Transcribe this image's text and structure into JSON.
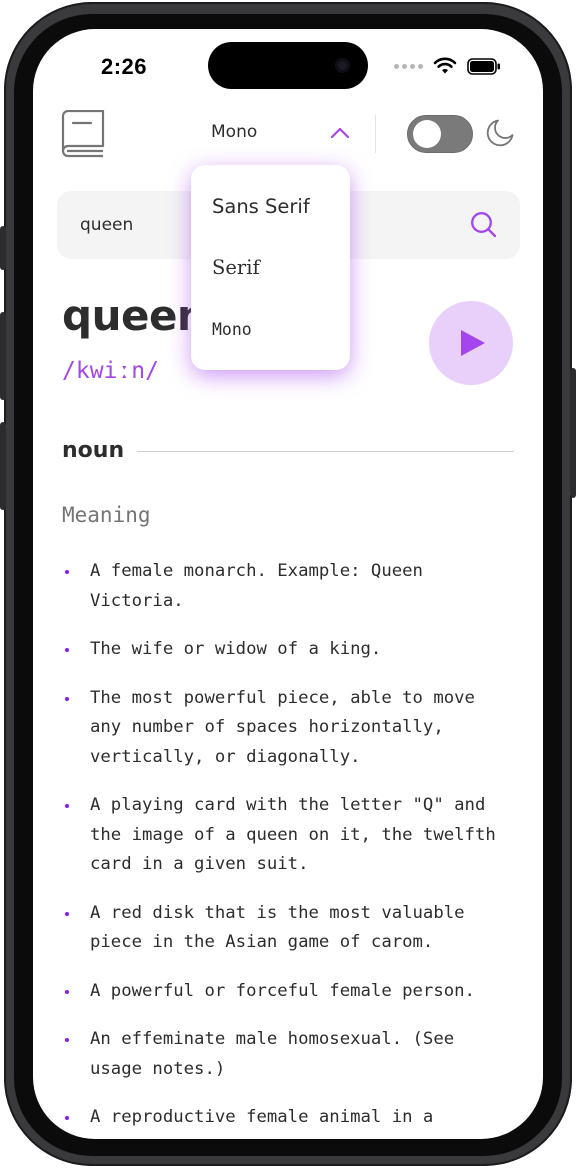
{
  "status_bar": {
    "time": "2:26"
  },
  "header": {
    "font_selected": "Mono",
    "theme_toggle_on": false
  },
  "search": {
    "value": "queen"
  },
  "entry": {
    "word": "queen",
    "phonetic": "/kwiːn/",
    "part_of_speech": "noun",
    "meaning_label": "Meaning",
    "definitions": [
      "A female monarch. Example: Queen Victoria.",
      "The wife or widow of a king.",
      "The most powerful piece, able to move any number of spaces horizontally, vertically, or diagonally.",
      "A playing card with the letter \"Q\" and the image of a queen on it, the twelfth card in a given suit.",
      "A red disk that is the most valuable piece in the Asian game of carom.",
      "A powerful or forceful female person.",
      "An effeminate male homosexual. (See usage notes.)",
      "A reproductive female animal in a"
    ]
  },
  "font_dropdown": {
    "options": [
      "Sans Serif",
      "Serif",
      "Mono"
    ]
  },
  "colors": {
    "accent": "#A445ED",
    "accent_light": "#E9D0FA",
    "text": "#2D2D2D",
    "muted": "#757575"
  },
  "icons": [
    "book-icon",
    "chevron-up-icon",
    "moon-icon",
    "search-icon",
    "play-icon",
    "wifi-icon",
    "battery-icon"
  ]
}
